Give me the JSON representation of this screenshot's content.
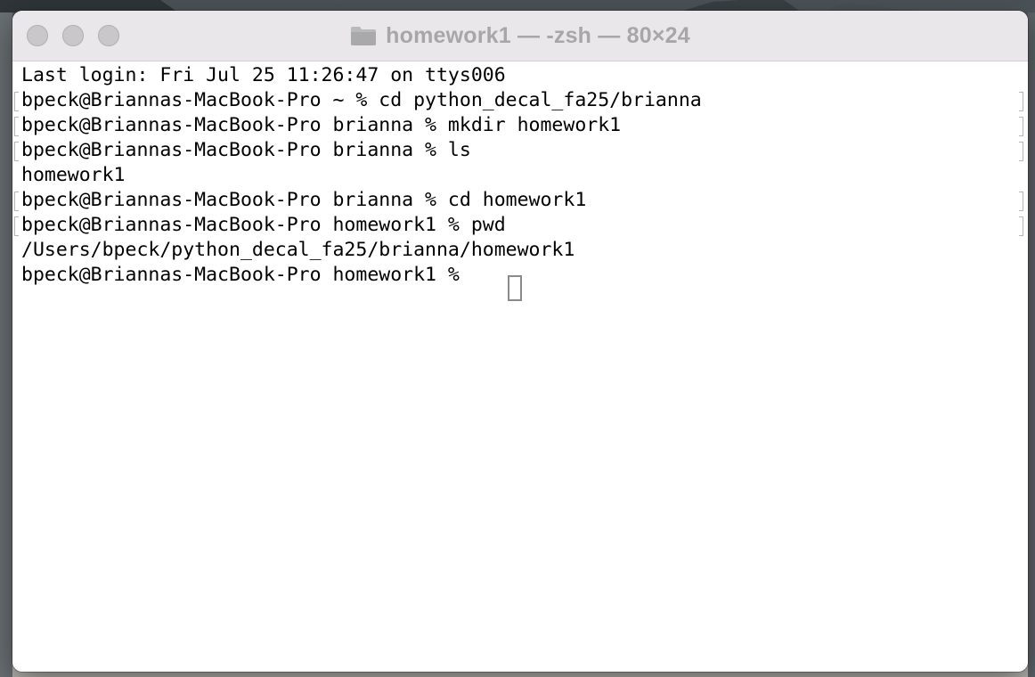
{
  "window": {
    "title": "homework1 — -zsh — 80×24"
  },
  "terminal": {
    "lines": [
      {
        "text": "Last login: Fri Jul 25 11:26:47 on ttys006",
        "marked": false
      },
      {
        "text": "bpeck@Briannas-MacBook-Pro ~ % cd python_decal_fa25/brianna",
        "marked": true
      },
      {
        "text": "bpeck@Briannas-MacBook-Pro brianna % mkdir homework1",
        "marked": true
      },
      {
        "text": "bpeck@Briannas-MacBook-Pro brianna % ls",
        "marked": true
      },
      {
        "text": "homework1",
        "marked": false
      },
      {
        "text": "bpeck@Briannas-MacBook-Pro brianna % cd homework1",
        "marked": true
      },
      {
        "text": "bpeck@Briannas-MacBook-Pro homework1 % pwd",
        "marked": true
      },
      {
        "text": "/Users/bpeck/python_decal_fa25/brianna/homework1",
        "marked": false
      },
      {
        "text": "bpeck@Briannas-MacBook-Pro homework1 % ",
        "marked": false
      }
    ]
  },
  "icons": {
    "title_icon": "folder-icon"
  },
  "colors": {
    "titlebar_bg": "#e9e7e9",
    "title_text": "#a7a6a8",
    "terminal_bg": "#ffffff",
    "terminal_text": "#000000",
    "traffic_light_inactive": "#c9c7c9"
  }
}
